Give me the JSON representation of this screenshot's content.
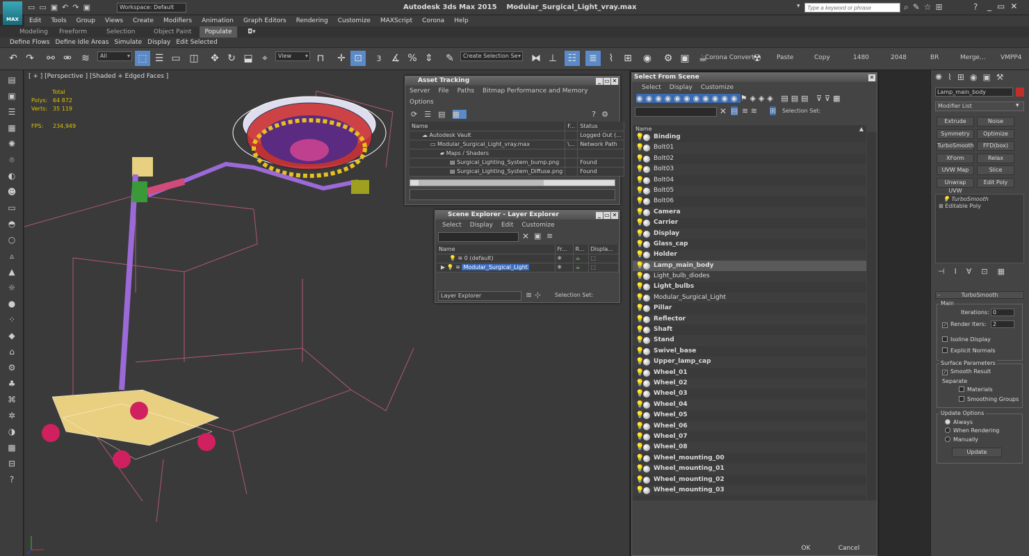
{
  "title_bar": {
    "app_title": "Autodesk 3ds Max  2015",
    "file_name": "Modular_Surgical_Light_vray.max",
    "workspace": "Workspace: Default",
    "search_placeholder": "Type a keyword or phrase",
    "logo": "MAX"
  },
  "menu": [
    "Edit",
    "Tools",
    "Group",
    "Views",
    "Create",
    "Modifiers",
    "Animation",
    "Graph Editors",
    "Rendering",
    "Customize",
    "MAXScript",
    "Corona",
    "Help"
  ],
  "ribbon_tabs": [
    "Modeling",
    "Freeform",
    "Selection",
    "Object Paint",
    "Populate"
  ],
  "ribbon_sub": [
    "Define Flows",
    "Define Idle Areas",
    "Simulate",
    "Display",
    "Edit Selected"
  ],
  "toolbar": {
    "filter": "All",
    "coord": "View",
    "snap_label": "3",
    "selection_set": "Create Selection Se",
    "corona_convert": "Corona Convert",
    "paste": "Paste",
    "copy": "Copy",
    "res_w": "1480",
    "res_h": "2048",
    "br": "BR",
    "merge": "Merge...",
    "vmpp": "VMPP4"
  },
  "viewport": {
    "label": "[ + ] [Perspective ] [Shaded + Edged Faces ]",
    "total_label": "Total",
    "polys_label": "Polys:",
    "polys_value": "64 872",
    "verts_label": "Verts:",
    "verts_value": "35 119",
    "fps_label": "FPS:",
    "fps_value": "234,949"
  },
  "asset_tracking": {
    "title": "Asset Tracking",
    "menu": [
      "Server",
      "File",
      "Paths",
      "Bitmap Performance and Memory",
      "Options"
    ],
    "col_name": "Name",
    "col_f": "F...",
    "col_status": "Status",
    "rows": [
      {
        "name": "Autodesk Vault",
        "f": "",
        "status": "Logged Out (..."
      },
      {
        "name": "Modular_Surgical_Light_vray.max",
        "f": "\\...",
        "status": "Network Path"
      },
      {
        "name": "Maps / Shaders",
        "f": "",
        "status": ""
      },
      {
        "name": "Surgical_Lighting_System_bump.png",
        "f": "",
        "status": "Found"
      },
      {
        "name": "Surgical_Lighting_System_Diffuse.png",
        "f": "",
        "status": "Found"
      }
    ]
  },
  "scene_explorer": {
    "title": "Scene Explorer - Layer Explorer",
    "menu": [
      "Select",
      "Display",
      "Edit",
      "Customize"
    ],
    "col_name": "Name",
    "col_fr": "Fr...",
    "col_r": "R...",
    "col_disp": "Displa...",
    "rows": [
      {
        "name": "0 (default)"
      },
      {
        "name": "Modular_Surgical_Light"
      }
    ],
    "footer_combo": "Layer Explorer",
    "footer_sel": "Selection Set:"
  },
  "select_from_scene": {
    "title": "Select From Scene",
    "menu": [
      "Select",
      "Display",
      "Customize"
    ],
    "selection_set": "Selection Set:",
    "col_name": "Name",
    "items": [
      {
        "name": "Binding",
        "bold": true
      },
      {
        "name": "Bolt01",
        "bold": false
      },
      {
        "name": "Bolt02",
        "bold": false
      },
      {
        "name": "Bolt03",
        "bold": false
      },
      {
        "name": "Bolt04",
        "bold": false
      },
      {
        "name": "Bolt05",
        "bold": false
      },
      {
        "name": "Bolt06",
        "bold": false
      },
      {
        "name": "Camera",
        "bold": true
      },
      {
        "name": "Carrier",
        "bold": true
      },
      {
        "name": "Display",
        "bold": true
      },
      {
        "name": "Glass_cap",
        "bold": true
      },
      {
        "name": "Holder",
        "bold": true
      },
      {
        "name": "Lamp_main_body",
        "bold": true,
        "selected": true
      },
      {
        "name": "Light_bulb_diodes",
        "bold": false
      },
      {
        "name": "Light_bulbs",
        "bold": true
      },
      {
        "name": "Modular_Surgical_Light",
        "bold": false
      },
      {
        "name": "Pillar",
        "bold": true
      },
      {
        "name": "Reflector",
        "bold": true
      },
      {
        "name": "Shaft",
        "bold": true
      },
      {
        "name": "Stand",
        "bold": true
      },
      {
        "name": "Swivel_base",
        "bold": true
      },
      {
        "name": "Upper_lamp_cap",
        "bold": true
      },
      {
        "name": "Wheel_01",
        "bold": true
      },
      {
        "name": "Wheel_02",
        "bold": true
      },
      {
        "name": "Wheel_03",
        "bold": true
      },
      {
        "name": "Wheel_04",
        "bold": true
      },
      {
        "name": "Wheel_05",
        "bold": true
      },
      {
        "name": "Wheel_06",
        "bold": true
      },
      {
        "name": "Wheel_07",
        "bold": true
      },
      {
        "name": "Wheel_08",
        "bold": true
      },
      {
        "name": "Wheel_mounting_00",
        "bold": true
      },
      {
        "name": "Wheel_mounting_01",
        "bold": true
      },
      {
        "name": "Wheel_mounting_02",
        "bold": true
      },
      {
        "name": "Wheel_mounting_03",
        "bold": true
      }
    ],
    "ok": "OK",
    "cancel": "Cancel"
  },
  "command_panel": {
    "object_name": "Lamp_main_body",
    "object_color": "#c0302a",
    "modifier_list": "Modifier List",
    "modifiers": [
      "Extrude",
      "Noise",
      "Symmetry",
      "Optimize",
      "TurboSmooth",
      "FFD(box)",
      "XForm",
      "Relax",
      "UVW Map",
      "Slice",
      "Unwrap UVW",
      "Edit Poly"
    ],
    "stack": [
      "TurboSmooth",
      "Editable Poly"
    ],
    "rollout_title": "TurboSmooth",
    "main_label": "Main",
    "iterations_label": "Iterations:",
    "iterations_value": "0",
    "render_iters_label": "Render Iters:",
    "render_iters_value": "2",
    "isoline": "Isoline Display",
    "explicit_normals": "Explicit Normals",
    "surface_params": "Surface Parameters",
    "smooth_result": "Smooth Result",
    "separate": "Separate",
    "materials": "Materials",
    "smoothing_groups": "Smoothing Groups",
    "update_options": "Update Options",
    "always": "Always",
    "when_rendering": "When Rendering",
    "manually": "Manually",
    "update_btn": "Update"
  }
}
